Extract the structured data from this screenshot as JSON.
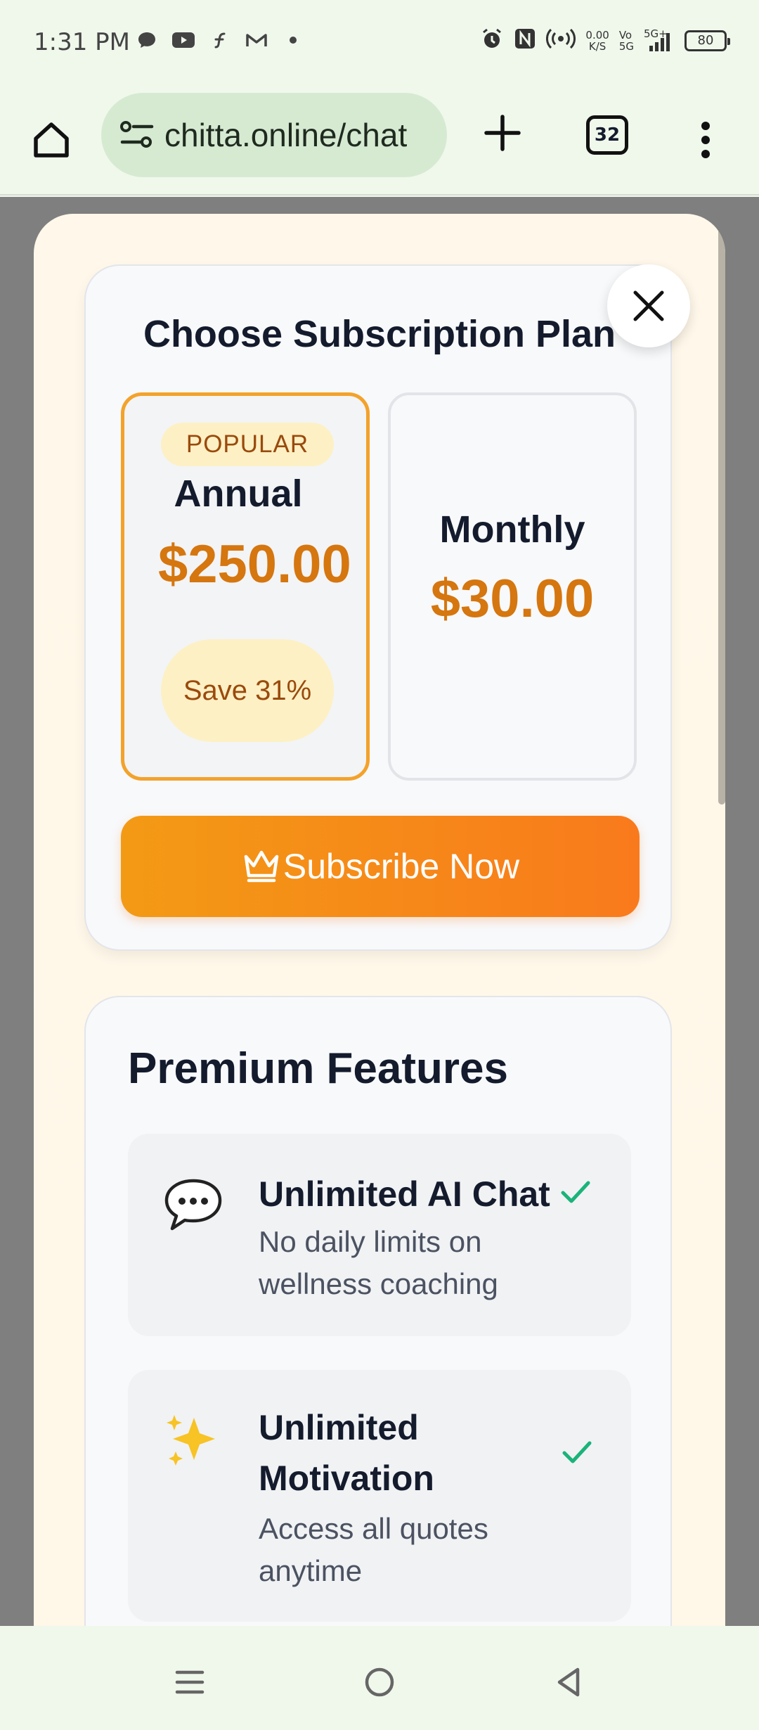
{
  "status_bar": {
    "time": "1:31 PM",
    "net_speed_value": "0.00",
    "net_speed_unit": "K/S",
    "volte": "Vo",
    "volte_sub": "5G",
    "network": "5G+",
    "battery": "80",
    "icons": [
      "chat-bubble-icon",
      "youtube-icon",
      "function-icon",
      "gmail-icon",
      "dot-icon",
      "alarm-icon",
      "nfc-icon",
      "hotspot-icon",
      "signal-icon"
    ]
  },
  "browser": {
    "url": "chitta.online/chat",
    "tab_count": "32"
  },
  "modal": {
    "plan_title": "Choose Subscription Plan",
    "plans": [
      {
        "badge": "POPULAR",
        "name": "Annual",
        "price": "$250.00",
        "save": "Save 31%",
        "selected": true
      },
      {
        "name": "Monthly",
        "price": "$30.00",
        "selected": false
      }
    ],
    "subscribe_label": "Subscribe Now",
    "features_title": "Premium Features",
    "features": [
      {
        "icon": "💬",
        "name": "Unlimited AI Chat",
        "desc": "No daily limits on wellness coaching"
      },
      {
        "icon": "✨",
        "name": "Unlimited Motivation",
        "desc": "Access all quotes anytime"
      }
    ]
  },
  "colors": {
    "accent_orange": "#d5760f",
    "button_start": "#f39a15",
    "button_end": "#f97a1c",
    "selected_border": "#f3a22b",
    "badge_bg": "#fdf0c4",
    "check_green": "#1bb37a",
    "chrome_bg": "#f0f8ec"
  }
}
